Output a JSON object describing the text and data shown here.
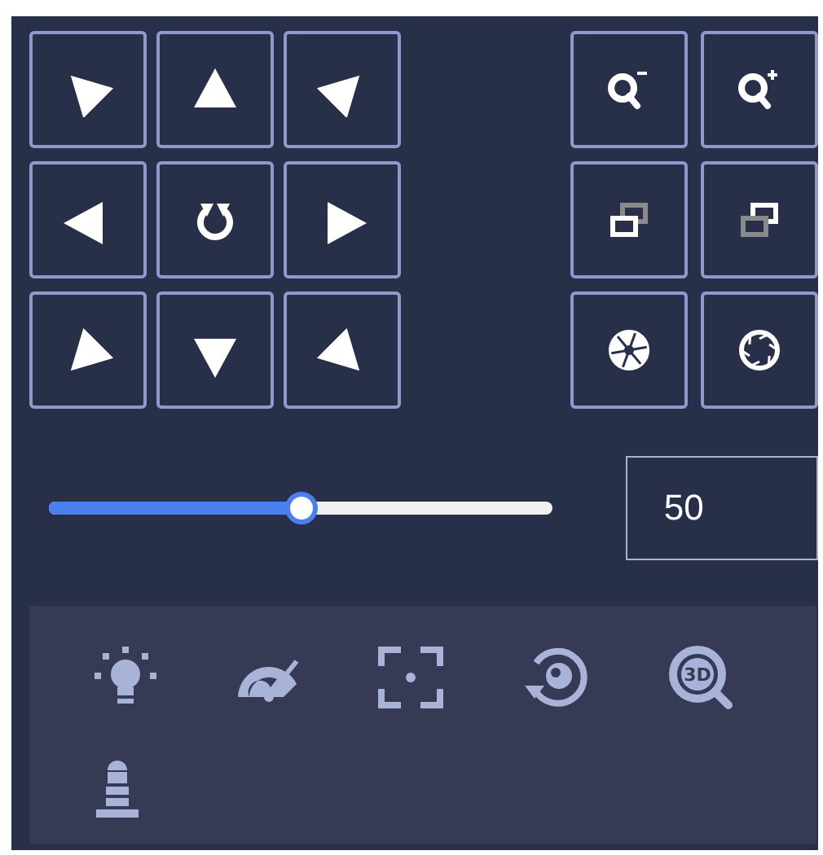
{
  "ptz_pad": [
    {
      "kind": "up-left"
    },
    {
      "kind": "up"
    },
    {
      "kind": "up-right"
    },
    {
      "kind": "left"
    },
    {
      "kind": "auto"
    },
    {
      "kind": "right"
    },
    {
      "kind": "down-left"
    },
    {
      "kind": "down"
    },
    {
      "kind": "down-right"
    }
  ],
  "lens": [
    {
      "kind": "zoom-out"
    },
    {
      "kind": "zoom-in"
    },
    {
      "kind": "focus-near"
    },
    {
      "kind": "focus-far"
    },
    {
      "kind": "iris-close"
    },
    {
      "kind": "iris-open"
    }
  ],
  "speed": {
    "level": 0.5,
    "value": "50"
  },
  "functions": [
    {
      "kind": "light"
    },
    {
      "kind": "speed"
    },
    {
      "kind": "focus-frame"
    },
    {
      "kind": "reset"
    },
    {
      "kind": "zoom-3d",
      "text": "3D"
    },
    {
      "kind": "tower"
    }
  ]
}
